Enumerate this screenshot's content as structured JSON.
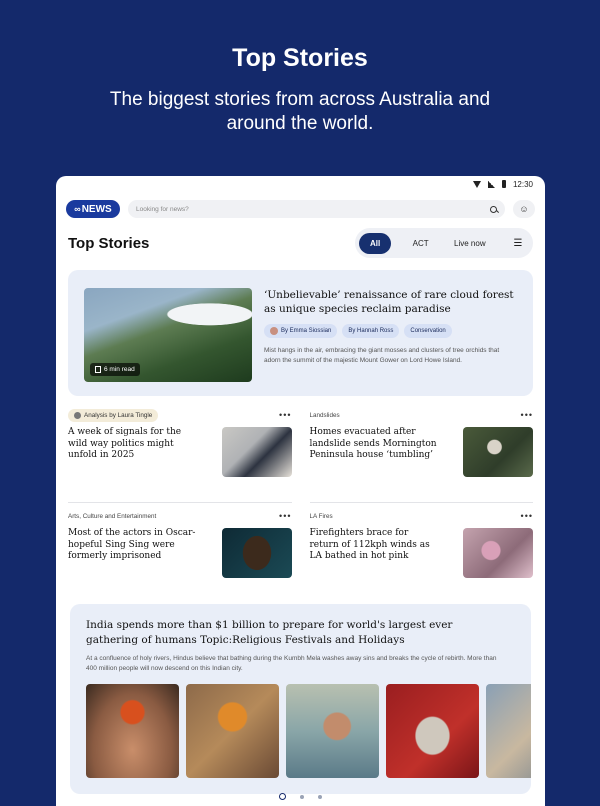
{
  "promo": {
    "title": "Top Stories",
    "subtitle": "The biggest stories from across Australia and around the world."
  },
  "status": {
    "time": "12:30"
  },
  "topbar": {
    "logo_text": "NEWS",
    "search_placeholder": "Looking for news?"
  },
  "page": {
    "title": "Top Stories",
    "filters": [
      "All",
      "ACT",
      "Live now"
    ],
    "active_filter": "All"
  },
  "hero": {
    "headline": "‘Unbelievable’ renaissance of rare cloud forest as unique species reclaim paradise",
    "read_time": "6 min read",
    "tags": [
      "By Emma Siossian",
      "By Hannah Ross",
      "Conservation"
    ],
    "summary": "Mist hangs in the air, embracing the giant mosses and clusters of tree orchids that adorn the summit of the majestic Mount Gower on Lord Howe Island."
  },
  "stories": [
    {
      "kicker": "Analysis by Laura Tingle",
      "headline": "A week of signals for the wild way politics might unfold in 2025"
    },
    {
      "kicker": "Landslides",
      "headline": "Homes evacuated after landslide sends Mornington Peninsula house ‘tumbling’"
    },
    {
      "kicker": "Arts, Culture and Entertainment",
      "headline": "Most of the actors in Oscar-hopeful Sing Sing were formerly imprisoned"
    },
    {
      "kicker": "LA Fires",
      "headline": "Firefighters brace for return of 112kph winds as LA bathed in hot pink"
    }
  ],
  "feature": {
    "headline": "India spends more than $1 billion to prepare for world's largest ever gathering of humans Topic:Religious Festivals and Holidays",
    "summary": "At a confluence of holy rivers, Hindus believe that bathing during the Kumbh Mela washes away sins and breaks the cycle of rebirth. More than 400 million people will now descend on this Indian city."
  },
  "pager": {
    "pages": 3,
    "current": 1
  },
  "colors": {
    "brand_navy": "#14296b",
    "active_chip": "#17306f",
    "card_bg": "#e9eef8"
  }
}
